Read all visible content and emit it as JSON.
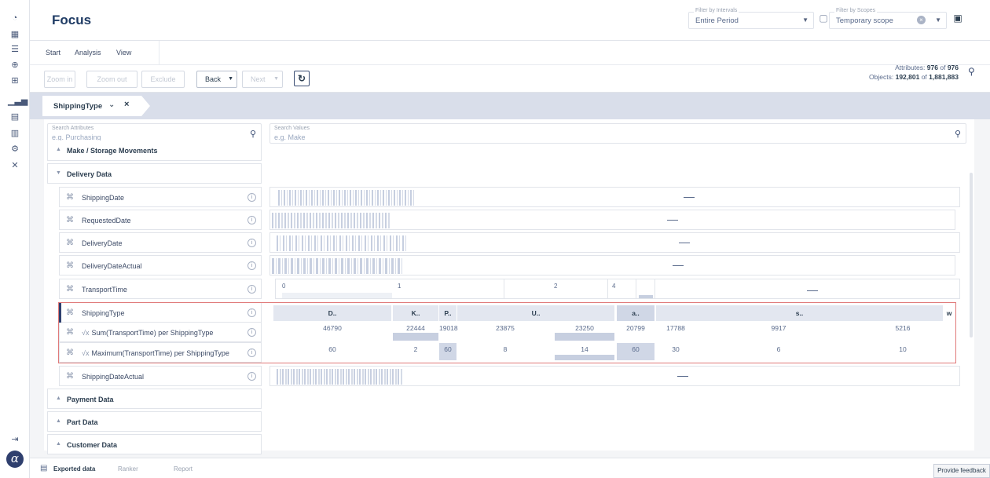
{
  "app": {
    "title": "Focus"
  },
  "header": {
    "intervals": {
      "label": "Filter by Intervals",
      "value": "Entire Period"
    },
    "scopes": {
      "label": "Filter by Scopes",
      "value": "Temporary scope"
    }
  },
  "tabs": [
    "Start",
    "Analysis",
    "View"
  ],
  "toolbar": {
    "zoom_in": "Zoom in",
    "zoom_out": "Zoom out",
    "exclude": "Exclude",
    "back": "Back",
    "next": "Next"
  },
  "stats": {
    "attributes_label": "Attributes:",
    "attributes_shown": "976",
    "attributes_of": "of",
    "attributes_total": "976",
    "objects_label": "Objects:",
    "objects_shown": "192,801",
    "objects_of": "of",
    "objects_total": "1,881,883"
  },
  "breadcrumb": {
    "label": "ShippingType"
  },
  "search_attributes": {
    "label": "Search Attributes",
    "placeholder": "e.g. Purchasing"
  },
  "search_values": {
    "label": "Search Values",
    "placeholder": "e.g. Make"
  },
  "groups": {
    "make": "Make / Storage Movements",
    "delivery": "Delivery Data",
    "payment": "Payment Data",
    "part": "Part Data",
    "customer": "Customer Data"
  },
  "attributes": {
    "shipping_date": "ShippingDate",
    "requested_date": "RequestedDate",
    "delivery_date": "DeliveryDate",
    "delivery_date_actual": "DeliveryDateActual",
    "transport_time": "TransportTime",
    "shipping_type": "ShippingType",
    "sum_tt": "Sum(TransportTime) per ShippingType",
    "max_tt": "Maximum(TransportTime) per ShippingType",
    "shipping_date_actual": "ShippingDateActual"
  },
  "sqrt_symbol": "√x",
  "transport_ticks": [
    "0",
    "1",
    "2",
    "4"
  ],
  "shipping_type_headers": [
    "D..",
    "K..",
    "P..",
    "U..",
    "a..",
    "s..",
    "w"
  ],
  "sum_values": [
    "46790",
    "22444",
    "19018",
    "23875",
    "23250",
    "20799",
    "17788",
    "9917",
    "5216"
  ],
  "max_values": [
    "60",
    "2",
    "60",
    "8",
    "14",
    "60",
    "30",
    "6",
    "10"
  ],
  "bottom": {
    "exported": "Exported data",
    "ranker": "Ranker",
    "report": "Report",
    "feedback": "Provide feedback"
  },
  "colors": {
    "accent": "#2f3f6e",
    "highlight": "#e07a7a",
    "bar_fill": "#c7cfe0"
  }
}
